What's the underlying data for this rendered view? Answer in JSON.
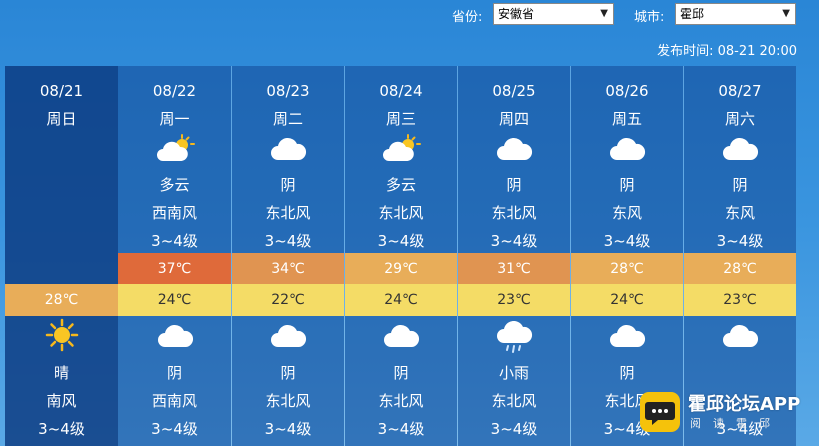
{
  "header": {
    "province_label": "省份:",
    "province_value": "安徽省",
    "city_label": "城市:",
    "city_value": "霍邱",
    "publish_label": "发布时间:",
    "publish_time": "08-21 20:00"
  },
  "colors": {
    "hot": "#df6a3a",
    "warm": "#e09451",
    "mild": "#e8ad59",
    "low_band": "#f4dc66"
  },
  "today": {
    "date": "08/21",
    "weekday": "周日",
    "temp": "28℃",
    "icon": "sun-icon",
    "weather": "晴",
    "wind_dir": "南风",
    "wind_level": "3~4级"
  },
  "days": [
    {
      "date": "08/22",
      "weekday": "周一",
      "day_icon": "partly-cloudy-icon",
      "day_weather": "多云",
      "day_wind": "西南风",
      "day_level": "3~4级",
      "high": "37℃",
      "low": "24℃",
      "night_icon": "cloud-icon",
      "night_weather": "阴",
      "night_wind": "西南风",
      "night_level": "3~4级",
      "hi_color": "#df6a3a"
    },
    {
      "date": "08/23",
      "weekday": "周二",
      "day_icon": "cloud-icon",
      "day_weather": "阴",
      "day_wind": "东北风",
      "day_level": "3~4级",
      "high": "34℃",
      "low": "22℃",
      "night_icon": "cloud-icon",
      "night_weather": "阴",
      "night_wind": "东北风",
      "night_level": "3~4级",
      "hi_color": "#e09451"
    },
    {
      "date": "08/24",
      "weekday": "周三",
      "day_icon": "partly-cloudy-icon",
      "day_weather": "多云",
      "day_wind": "东北风",
      "day_level": "3~4级",
      "high": "29℃",
      "low": "24℃",
      "night_icon": "cloud-icon",
      "night_weather": "阴",
      "night_wind": "东北风",
      "night_level": "3~4级",
      "hi_color": "#e8ad59"
    },
    {
      "date": "08/25",
      "weekday": "周四",
      "day_icon": "cloud-icon",
      "day_weather": "阴",
      "day_wind": "东北风",
      "day_level": "3~4级",
      "high": "31℃",
      "low": "23℃",
      "night_icon": "rain-icon",
      "night_weather": "小雨",
      "night_wind": "东北风",
      "night_level": "3~4级",
      "hi_color": "#e09451"
    },
    {
      "date": "08/26",
      "weekday": "周五",
      "day_icon": "cloud-icon",
      "day_weather": "阴",
      "day_wind": "东风",
      "day_level": "3~4级",
      "high": "28℃",
      "low": "24℃",
      "night_icon": "cloud-icon",
      "night_weather": "阴",
      "night_wind": "东北风",
      "night_level": "3~4级",
      "hi_color": "#e8ad59"
    },
    {
      "date": "08/27",
      "weekday": "周六",
      "day_icon": "cloud-icon",
      "day_weather": "阴",
      "day_wind": "东风",
      "day_level": "3~4级",
      "high": "28℃",
      "low": "23℃",
      "night_icon": "cloud-icon",
      "night_weather": "",
      "night_wind": "",
      "night_level": "3~4级",
      "hi_color": "#e8ad59"
    }
  ],
  "watermark": {
    "title": "霍邱论坛APP",
    "subtitle": "阅读霍邱"
  }
}
